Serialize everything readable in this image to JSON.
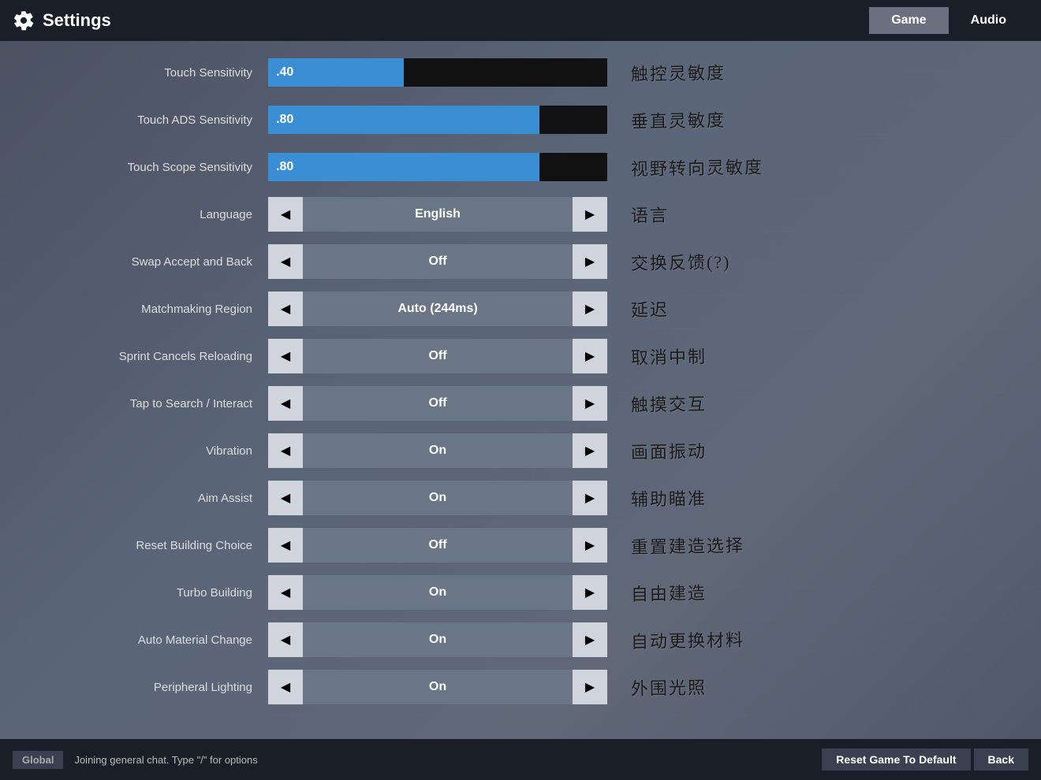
{
  "header": {
    "title": "Settings",
    "tabs": [
      {
        "label": "Game",
        "active": true
      },
      {
        "label": "Audio",
        "active": false
      }
    ]
  },
  "settings": [
    {
      "id": "touch-sensitivity",
      "label": "Touch Sensitivity",
      "type": "slider",
      "value": ".40",
      "fillPercent": 40,
      "chinese": "触控灵敏度"
    },
    {
      "id": "touch-ads-sensitivity",
      "label": "Touch ADS Sensitivity",
      "type": "slider",
      "value": ".80",
      "fillPercent": 80,
      "chinese": "垂直灵敏度"
    },
    {
      "id": "touch-scope-sensitivity",
      "label": "Touch Scope Sensitivity",
      "type": "slider",
      "value": ".80",
      "fillPercent": 80,
      "chinese": "视野转向灵敏度"
    },
    {
      "id": "language",
      "label": "Language",
      "type": "select",
      "value": "English",
      "chinese": "语言"
    },
    {
      "id": "swap-accept-back",
      "label": "Swap Accept and Back",
      "type": "select",
      "value": "Off",
      "chinese": "交换反馈(?)"
    },
    {
      "id": "matchmaking-region",
      "label": "Matchmaking Region",
      "type": "select",
      "value": "Auto (244ms)",
      "chinese": "延迟"
    },
    {
      "id": "sprint-cancels-reloading",
      "label": "Sprint Cancels Reloading",
      "type": "select",
      "value": "Off",
      "chinese": "取消中制"
    },
    {
      "id": "tap-to-search",
      "label": "Tap to Search / Interact",
      "type": "select",
      "value": "Off",
      "chinese": "触摸交互"
    },
    {
      "id": "vibration",
      "label": "Vibration",
      "type": "select",
      "value": "On",
      "chinese": "画面振动"
    },
    {
      "id": "aim-assist",
      "label": "Aim Assist",
      "type": "select",
      "value": "On",
      "chinese": "辅助瞄准"
    },
    {
      "id": "reset-building-choice",
      "label": "Reset Building Choice",
      "type": "select",
      "value": "Off",
      "chinese": "重置建造选择"
    },
    {
      "id": "turbo-building",
      "label": "Turbo Building",
      "type": "select",
      "value": "On",
      "chinese": "自由建造"
    },
    {
      "id": "auto-material-change",
      "label": "Auto Material Change",
      "type": "select",
      "value": "On",
      "chinese": "自动更换材料"
    },
    {
      "id": "peripheral-lighting",
      "label": "Peripheral Lighting",
      "type": "select",
      "value": "On",
      "chinese": "外围光照"
    }
  ],
  "footer": {
    "badge": "Global",
    "chat": "Joining general chat. Type \"/\" for options",
    "buttons": [
      "Reset Game To Default",
      "Back"
    ]
  }
}
